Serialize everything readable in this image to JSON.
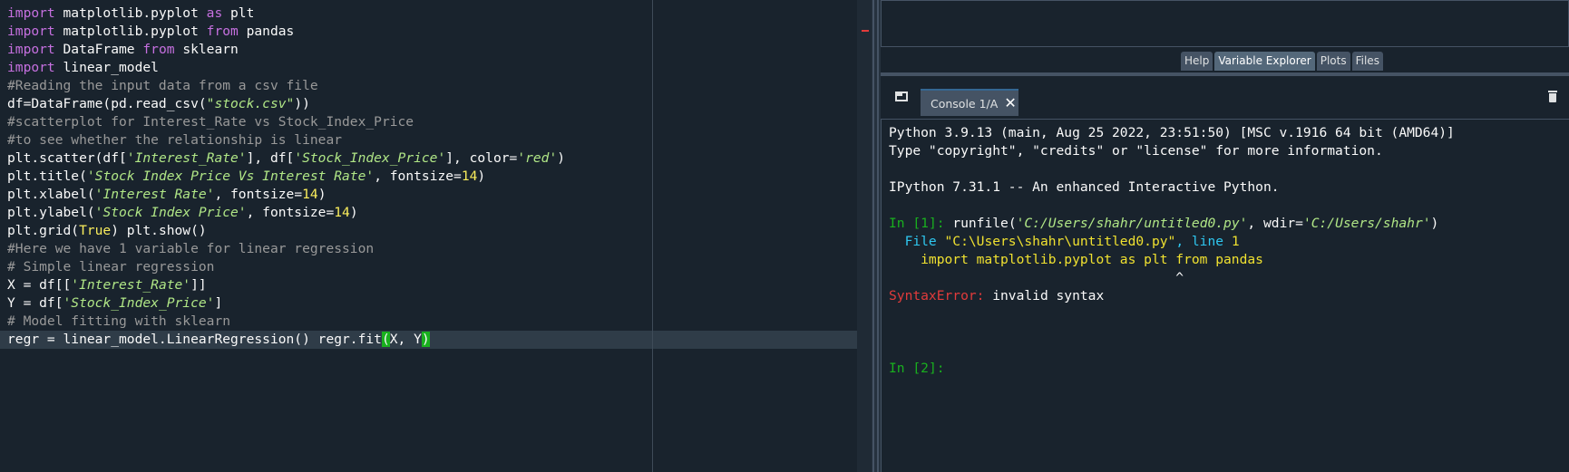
{
  "editor": {
    "lines": [
      [
        {
          "t": "import",
          "c": "kw"
        },
        {
          "t": " matplotlib.pyplot ",
          "c": "def"
        },
        {
          "t": "as",
          "c": "kw"
        },
        {
          "t": " plt",
          "c": "def"
        }
      ],
      [
        {
          "t": "import",
          "c": "kw"
        },
        {
          "t": " matplotlib.pyplot ",
          "c": "def"
        },
        {
          "t": "from",
          "c": "kw"
        },
        {
          "t": " pandas",
          "c": "def"
        }
      ],
      [
        {
          "t": "import",
          "c": "kw"
        },
        {
          "t": " DataFrame ",
          "c": "def"
        },
        {
          "t": "from",
          "c": "kw"
        },
        {
          "t": " sklearn",
          "c": "def"
        }
      ],
      [
        {
          "t": "import",
          "c": "kw"
        },
        {
          "t": " linear_model",
          "c": "def"
        }
      ],
      [
        {
          "t": "#Reading the input data from a csv file",
          "c": "com"
        }
      ],
      [
        {
          "t": "df=DataFrame(pd.read_csv(",
          "c": "def"
        },
        {
          "t": "\"stock.csv\"",
          "c": "str"
        },
        {
          "t": "))",
          "c": "def"
        }
      ],
      [
        {
          "t": "#scatterplot for Interest_Rate vs Stock_Index_Price",
          "c": "com"
        }
      ],
      [
        {
          "t": "#to see whether the relationship is linear",
          "c": "com"
        }
      ],
      [
        {
          "t": "plt.scatter(df[",
          "c": "def"
        },
        {
          "t": "'Interest_Rate'",
          "c": "str"
        },
        {
          "t": "], df[",
          "c": "def"
        },
        {
          "t": "'Stock_Index_Price'",
          "c": "str"
        },
        {
          "t": "], color=",
          "c": "def"
        },
        {
          "t": "'red'",
          "c": "str"
        },
        {
          "t": ")",
          "c": "def"
        }
      ],
      [
        {
          "t": "plt.title(",
          "c": "def"
        },
        {
          "t": "'Stock Index Price Vs Interest Rate'",
          "c": "str"
        },
        {
          "t": ", fontsize=",
          "c": "def"
        },
        {
          "t": "14",
          "c": "num"
        },
        {
          "t": ")",
          "c": "def"
        }
      ],
      [
        {
          "t": "plt.xlabel(",
          "c": "def"
        },
        {
          "t": "'Interest Rate'",
          "c": "str"
        },
        {
          "t": ", fontsize=",
          "c": "def"
        },
        {
          "t": "14",
          "c": "num"
        },
        {
          "t": ")",
          "c": "def"
        }
      ],
      [
        {
          "t": "plt.ylabel(",
          "c": "def"
        },
        {
          "t": "'Stock Index Price'",
          "c": "str"
        },
        {
          "t": ", fontsize=",
          "c": "def"
        },
        {
          "t": "14",
          "c": "num"
        },
        {
          "t": ")",
          "c": "def"
        }
      ],
      [
        {
          "t": "plt.grid(",
          "c": "def"
        },
        {
          "t": "True",
          "c": "num"
        },
        {
          "t": ") plt.show()",
          "c": "def"
        }
      ],
      [
        {
          "t": "#Here we have 1 variable for linear regression",
          "c": "com"
        }
      ],
      [
        {
          "t": "# Simple linear regression",
          "c": "com"
        }
      ],
      [
        {
          "t": "X = df[[",
          "c": "def"
        },
        {
          "t": "'Interest_Rate'",
          "c": "str"
        },
        {
          "t": "]]",
          "c": "def"
        }
      ],
      [
        {
          "t": "Y = df[",
          "c": "def"
        },
        {
          "t": "'Stock_Index_Price'",
          "c": "str"
        },
        {
          "t": "]",
          "c": "def"
        }
      ],
      [
        {
          "t": "# Model fitting with sklearn",
          "c": "com"
        }
      ],
      [
        {
          "t": "regr = linear_model.LinearRegression() regr.fit",
          "c": "def"
        },
        {
          "t": "(",
          "c": "bm"
        },
        {
          "t": "X, Y",
          "c": "def"
        },
        {
          "t": ")",
          "c": "bm"
        }
      ]
    ],
    "current_line": 18
  },
  "pane_tabs": [
    {
      "label": "Help",
      "active": false,
      "name": "tab-help"
    },
    {
      "label": "Variable Explorer",
      "active": true,
      "name": "tab-variable-explorer"
    },
    {
      "label": "Plots",
      "active": false,
      "name": "tab-plots"
    },
    {
      "label": "Files",
      "active": false,
      "name": "tab-files"
    }
  ],
  "console_tab": {
    "label": "Console 1/A",
    "close": "✕"
  },
  "icons": {
    "browse_tabs": "browse-tabs-icon",
    "close": "close-icon",
    "trash": "trash-icon"
  },
  "console": {
    "lines": [
      [
        {
          "t": "Python 3.9.13 (main, Aug 25 2022, 23:51:50) [MSC v.1916 64 bit (AMD64)]",
          "c": "def"
        }
      ],
      [
        {
          "t": "Type \"copyright\", \"credits\" or \"license\" for more information.",
          "c": "def"
        }
      ],
      [],
      [
        {
          "t": "IPython 7.31.1 -- An enhanced Interactive Python.",
          "c": "def"
        }
      ],
      [],
      [
        {
          "t": "In [",
          "c": "green"
        },
        {
          "t": "1",
          "c": "green"
        },
        {
          "t": "]: ",
          "c": "green"
        },
        {
          "t": "runfile(",
          "c": "def"
        },
        {
          "t": "'C:/Users/shahr/untitled0.py'",
          "c": "str"
        },
        {
          "t": ", wdir=",
          "c": "def"
        },
        {
          "t": "'C:/Users/shahr'",
          "c": "str"
        },
        {
          "t": ")",
          "c": "def"
        }
      ],
      [
        {
          "t": "  File ",
          "c": "file"
        },
        {
          "t": "\"C:\\Users\\shahr\\untitled0.py\"",
          "c": "yel"
        },
        {
          "t": ", line ",
          "c": "file"
        },
        {
          "t": "1",
          "c": "yel"
        }
      ],
      [
        {
          "t": "    import matplotlib.pyplot as plt from pandas",
          "c": "yel"
        }
      ],
      [
        {
          "t": "                                    ^",
          "c": "def"
        }
      ],
      [
        {
          "t": "SyntaxError:",
          "c": "err"
        },
        {
          "t": " invalid syntax",
          "c": "def"
        }
      ],
      [],
      [],
      [],
      [
        {
          "t": "In [",
          "c": "green"
        },
        {
          "t": "2",
          "c": "green"
        },
        {
          "t": "]: ",
          "c": "green"
        }
      ]
    ]
  },
  "colors": {
    "background": "#19232d",
    "keyword": "#c670e0",
    "string": "#b0e686",
    "number": "#faed5c",
    "comment": "#999999",
    "prompt": "#19b01e",
    "error": "#e23b3b"
  }
}
